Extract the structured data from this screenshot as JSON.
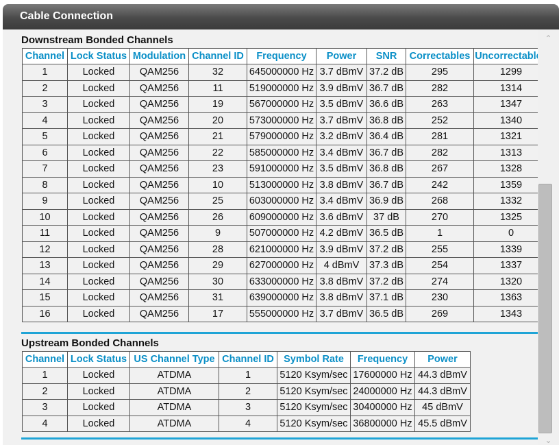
{
  "window": {
    "title": "Cable Connection"
  },
  "downstream": {
    "title": "Downstream Bonded Channels",
    "headers": [
      "Channel",
      "Lock Status",
      "Modulation",
      "Channel ID",
      "Frequency",
      "Power",
      "SNR",
      "Correctables",
      "Uncorrectables"
    ],
    "rows": [
      [
        "1",
        "Locked",
        "QAM256",
        "32",
        "645000000 Hz",
        "3.7 dBmV",
        "37.2 dB",
        "295",
        "1299"
      ],
      [
        "2",
        "Locked",
        "QAM256",
        "11",
        "519000000 Hz",
        "3.9 dBmV",
        "36.7 dB",
        "282",
        "1314"
      ],
      [
        "3",
        "Locked",
        "QAM256",
        "19",
        "567000000 Hz",
        "3.5 dBmV",
        "36.6 dB",
        "263",
        "1347"
      ],
      [
        "4",
        "Locked",
        "QAM256",
        "20",
        "573000000 Hz",
        "3.7 dBmV",
        "36.8 dB",
        "252",
        "1340"
      ],
      [
        "5",
        "Locked",
        "QAM256",
        "21",
        "579000000 Hz",
        "3.2 dBmV",
        "36.4 dB",
        "281",
        "1321"
      ],
      [
        "6",
        "Locked",
        "QAM256",
        "22",
        "585000000 Hz",
        "3.4 dBmV",
        "36.7 dB",
        "282",
        "1313"
      ],
      [
        "7",
        "Locked",
        "QAM256",
        "23",
        "591000000 Hz",
        "3.5 dBmV",
        "36.8 dB",
        "267",
        "1328"
      ],
      [
        "8",
        "Locked",
        "QAM256",
        "10",
        "513000000 Hz",
        "3.8 dBmV",
        "36.7 dB",
        "242",
        "1359"
      ],
      [
        "9",
        "Locked",
        "QAM256",
        "25",
        "603000000 Hz",
        "3.4 dBmV",
        "36.9 dB",
        "268",
        "1332"
      ],
      [
        "10",
        "Locked",
        "QAM256",
        "26",
        "609000000 Hz",
        "3.6 dBmV",
        "37 dB",
        "270",
        "1325"
      ],
      [
        "11",
        "Locked",
        "QAM256",
        "9",
        "507000000 Hz",
        "4.2 dBmV",
        "36.5 dB",
        "1",
        "0"
      ],
      [
        "12",
        "Locked",
        "QAM256",
        "28",
        "621000000 Hz",
        "3.9 dBmV",
        "37.2 dB",
        "255",
        "1339"
      ],
      [
        "13",
        "Locked",
        "QAM256",
        "29",
        "627000000 Hz",
        "4 dBmV",
        "37.3 dB",
        "254",
        "1337"
      ],
      [
        "14",
        "Locked",
        "QAM256",
        "30",
        "633000000 Hz",
        "3.8 dBmV",
        "37.2 dB",
        "274",
        "1320"
      ],
      [
        "15",
        "Locked",
        "QAM256",
        "31",
        "639000000 Hz",
        "3.8 dBmV",
        "37.1 dB",
        "230",
        "1363"
      ],
      [
        "16",
        "Locked",
        "QAM256",
        "17",
        "555000000 Hz",
        "3.7 dBmV",
        "36.5 dB",
        "269",
        "1343"
      ]
    ]
  },
  "upstream": {
    "title": "Upstream Bonded Channels",
    "headers": [
      "Channel",
      "Lock Status",
      "US Channel Type",
      "Channel ID",
      "Symbol Rate",
      "Frequency",
      "Power"
    ],
    "rows": [
      [
        "1",
        "Locked",
        "ATDMA",
        "1",
        "5120 Ksym/sec",
        "17600000 Hz",
        "44.3 dBmV"
      ],
      [
        "2",
        "Locked",
        "ATDMA",
        "2",
        "5120 Ksym/sec",
        "24000000 Hz",
        "44.3 dBmV"
      ],
      [
        "3",
        "Locked",
        "ATDMA",
        "3",
        "5120 Ksym/sec",
        "30400000 Hz",
        "45 dBmV"
      ],
      [
        "4",
        "Locked",
        "ATDMA",
        "4",
        "5120 Ksym/sec",
        "36800000 Hz",
        "45.5 dBmV"
      ]
    ]
  },
  "colors": {
    "header_text": "#0a8fc7",
    "rule": "#1fa4d6",
    "titlebar": "#4a4a4a"
  },
  "icons": {
    "scroll_up": "chevron-up-icon",
    "scroll_down": "chevron-down-icon"
  }
}
